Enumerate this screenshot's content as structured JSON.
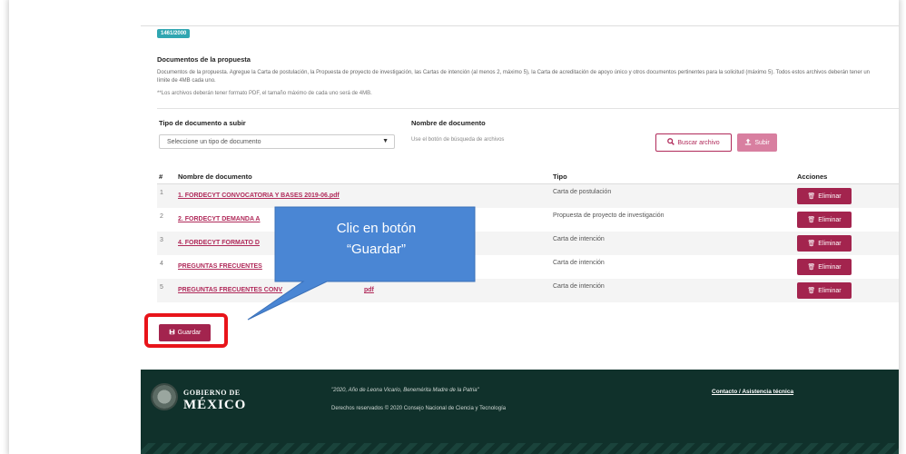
{
  "badge": "1461/2000",
  "section": {
    "title": "Documentos de la propuesta",
    "description": "Documentos de la propuesta. Agregue la Carta de postulación, la Propuesta de proyecto de investigación, las Cartas de intención (al menos 2, máximo 5), la Carta de acreditación de apoyo único y otros documentos pertinentes para la solicitud (máximo 5). Todos estos archivos deberán tener un límite de 4MB cada uno.",
    "note": "**Los archivos deberán tener formato PDF, el tamaño máximo de cada uno será de 4MB."
  },
  "upload": {
    "type_label": "Tipo de documento a subir",
    "type_placeholder": "Seleccione un tipo de documento",
    "name_label": "Nombre de documento",
    "name_helper": "Use el botón de búsqueda de archivos",
    "search_button": "Buscar archivo",
    "upload_button": "Subir"
  },
  "table": {
    "headers": {
      "num": "#",
      "name": "Nombre de documento",
      "type": "Tipo",
      "actions": "Acciones"
    },
    "delete_label": "Eliminar",
    "rows": [
      {
        "num": "1",
        "name": "1. FORDECYT CONVOCATORIA Y BASES 2019-06.pdf",
        "type": "Carta de postulación"
      },
      {
        "num": "2",
        "name": "2. FORDECYT DEMANDA A",
        "type": "Propuesta de proyecto de investigación"
      },
      {
        "num": "3",
        "name": "4. FORDECYT FORMATO D",
        "type": "Carta de intención"
      },
      {
        "num": "4",
        "name": "PREGUNTAS FRECUENTES",
        "type": "Carta de intención"
      },
      {
        "num": "5",
        "name": "PREGUNTAS FRECUENTES CONV",
        "name_tail": "pdf",
        "type": "Carta de intención"
      }
    ]
  },
  "save_button": "Guardar",
  "callout": {
    "line1": "Clic en botón",
    "line2": "“Guardar”"
  },
  "footer": {
    "gov_line1": "GOBIERNO DE",
    "gov_line2": "MÉXICO",
    "quote": "\"2020, Año de Leona Vicario, Benemérita Madre de la Patria\"",
    "copyright": "Derechos reservados © 2020 Consejo Nacional de Ciencia y Tecnología",
    "contact_link": "Contacto / Asistencia técnica"
  },
  "colors": {
    "accent": "#a3244e",
    "footer_bg": "#10312b",
    "badge": "#2fa6b1",
    "callout": "#4a86d4",
    "highlight": "#e8141a"
  },
  "icons": {
    "search": "search-icon",
    "upload": "upload-icon",
    "delete": "trash-icon",
    "save": "save-icon",
    "dropdown": "caret-down-icon"
  }
}
